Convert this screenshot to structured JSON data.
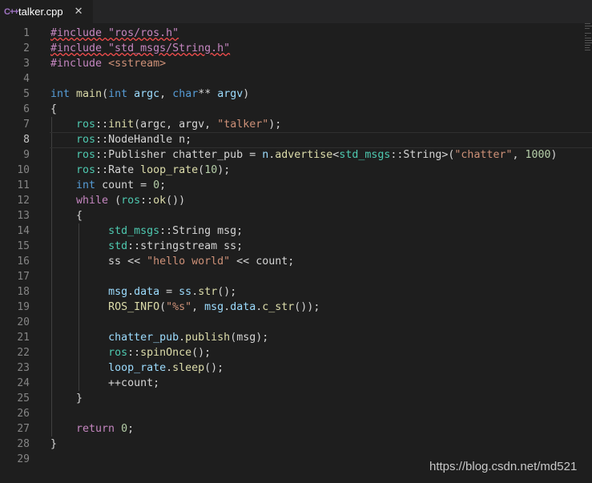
{
  "tab": {
    "icon_text": "C++",
    "filename": "talker.cpp",
    "close_glyph": "✕"
  },
  "editor": {
    "active_line": 8,
    "line_numbers": [
      "1",
      "2",
      "3",
      "4",
      "5",
      "6",
      "7",
      "8",
      "9",
      "10",
      "11",
      "12",
      "13",
      "14",
      "15",
      "16",
      "17",
      "18",
      "19",
      "20",
      "21",
      "22",
      "23",
      "24",
      "25",
      "26",
      "27",
      "28",
      "29"
    ],
    "lines": [
      [
        [
          "#include \"ros/ros.h\"",
          "ctl squig"
        ]
      ],
      [
        [
          "#include \"std_msgs/String.h\"",
          "ctl squig"
        ]
      ],
      [
        [
          "#include ",
          "ctl"
        ],
        [
          "<sstream>",
          "str"
        ]
      ],
      [],
      [
        [
          "int",
          "kw"
        ],
        [
          " "
        ],
        [
          "main",
          "fn"
        ],
        [
          "("
        ],
        [
          "int",
          "kw"
        ],
        [
          " "
        ],
        [
          "argc",
          "var"
        ],
        [
          ", "
        ],
        [
          "char",
          "kw"
        ],
        [
          "** "
        ],
        [
          "argv",
          "var"
        ],
        [
          ")"
        ]
      ],
      [
        [
          "{"
        ]
      ],
      [
        [
          "    "
        ],
        [
          "ros",
          "ns"
        ],
        [
          "::"
        ],
        [
          "init",
          "fn"
        ],
        [
          "(argc, argv, "
        ],
        [
          "\"talker\"",
          "str"
        ],
        [
          ");"
        ]
      ],
      [
        [
          "    "
        ],
        [
          "ros",
          "ns"
        ],
        [
          "::NodeHandle n;"
        ]
      ],
      [
        [
          "    "
        ],
        [
          "ros",
          "ns"
        ],
        [
          "::Publisher chatter_pub = "
        ],
        [
          "n",
          "var"
        ],
        [
          "."
        ],
        [
          "advertise",
          "fn"
        ],
        [
          "<"
        ],
        [
          "std_msgs",
          "ns"
        ],
        [
          "::String>("
        ],
        [
          "\"chatter\"",
          "str"
        ],
        [
          ", "
        ],
        [
          "1000",
          "num"
        ],
        [
          ")"
        ]
      ],
      [
        [
          "    "
        ],
        [
          "ros",
          "ns"
        ],
        [
          "::Rate "
        ],
        [
          "loop_rate",
          "fn"
        ],
        [
          "("
        ],
        [
          "10",
          "num"
        ],
        [
          ");"
        ]
      ],
      [
        [
          "    "
        ],
        [
          "int",
          "kw"
        ],
        [
          " count = "
        ],
        [
          "0",
          "num"
        ],
        [
          ";"
        ]
      ],
      [
        [
          "    "
        ],
        [
          "while",
          "ctl"
        ],
        [
          " ("
        ],
        [
          "ros",
          "ns"
        ],
        [
          "::"
        ],
        [
          "ok",
          "fn"
        ],
        [
          "())"
        ]
      ],
      [
        [
          "    {"
        ]
      ],
      [
        [
          "         "
        ],
        [
          "std_msgs",
          "ns"
        ],
        [
          "::String msg;"
        ]
      ],
      [
        [
          "         "
        ],
        [
          "std",
          "ns"
        ],
        [
          "::stringstream ss;"
        ]
      ],
      [
        [
          "         ss << "
        ],
        [
          "\"hello world\"",
          "str"
        ],
        [
          " << count;"
        ]
      ],
      [],
      [
        [
          "         "
        ],
        [
          "msg",
          "var"
        ],
        [
          "."
        ],
        [
          "data",
          "var"
        ],
        [
          " = "
        ],
        [
          "ss",
          "var"
        ],
        [
          "."
        ],
        [
          "str",
          "fn"
        ],
        [
          "();"
        ]
      ],
      [
        [
          "         "
        ],
        [
          "ROS_INFO",
          "fn"
        ],
        [
          "("
        ],
        [
          "\"%s\"",
          "str"
        ],
        [
          ", "
        ],
        [
          "msg",
          "var"
        ],
        [
          "."
        ],
        [
          "data",
          "var"
        ],
        [
          "."
        ],
        [
          "c_str",
          "fn"
        ],
        [
          "());"
        ]
      ],
      [],
      [
        [
          "         "
        ],
        [
          "chatter_pub",
          "var"
        ],
        [
          "."
        ],
        [
          "publish",
          "fn"
        ],
        [
          "(msg);"
        ]
      ],
      [
        [
          "         "
        ],
        [
          "ros",
          "ns"
        ],
        [
          "::"
        ],
        [
          "spinOnce",
          "fn"
        ],
        [
          "();"
        ]
      ],
      [
        [
          "         "
        ],
        [
          "loop_rate",
          "var"
        ],
        [
          "."
        ],
        [
          "sleep",
          "fn"
        ],
        [
          "();"
        ]
      ],
      [
        [
          "         ++count;"
        ]
      ],
      [
        [
          "    }"
        ]
      ],
      [],
      [
        [
          "    "
        ],
        [
          "return",
          "ctl"
        ],
        [
          " "
        ],
        [
          "0",
          "num"
        ],
        [
          ";"
        ]
      ],
      [
        [
          "}"
        ]
      ],
      []
    ]
  },
  "watermark": "https://blog.csdn.net/md521"
}
